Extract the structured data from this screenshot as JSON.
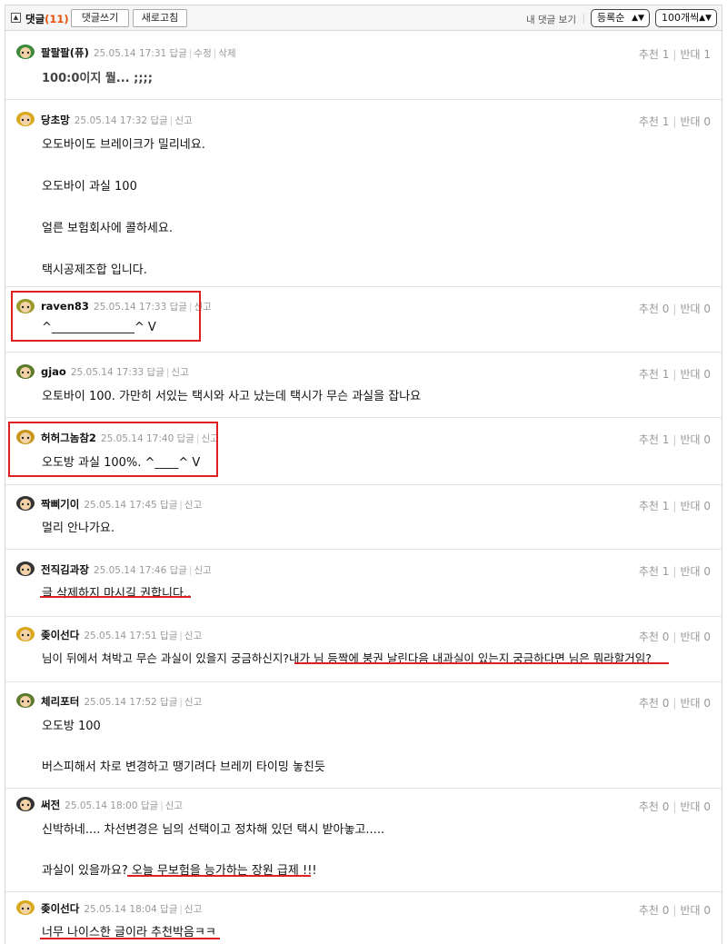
{
  "header": {
    "title": "댓글",
    "count": "(11)",
    "write_button": "댓글쓰기",
    "refresh_button": "새로고침",
    "my_comments": "내 댓글 보기",
    "sort_select": "등록순",
    "per_page_select": "100개씩"
  },
  "actions": {
    "reply": "답글",
    "edit": "수정",
    "delete": "삭제",
    "report": "신고",
    "up": "추천",
    "down": "반대"
  },
  "comments": [
    {
      "author": "팔팔팔(퓨)",
      "time": "25.05.14 17:31",
      "own": true,
      "up": "1",
      "down": "1",
      "lines": [
        "100:0이지 뭘... ;;;;"
      ],
      "avatar_color": "#3c8a3c"
    },
    {
      "author": "당초망",
      "time": "25.05.14 17:32",
      "own": false,
      "up": "1",
      "down": "0",
      "lines": [
        "오도바이도 브레이크가 밀리네요.",
        "오도바이 과실 100",
        "얼른 보험회사에 콜하세요.",
        "택시공제조합 입니다."
      ],
      "avatar_color": "#d9a81c"
    },
    {
      "author": "raven83",
      "time": "25.05.14 17:33",
      "own": false,
      "up": "0",
      "down": "0",
      "lines": [
        "^______________^ V"
      ],
      "avatar_color": "#9a9a2c"
    },
    {
      "author": "gjao",
      "time": "25.05.14 17:33",
      "own": false,
      "up": "1",
      "down": "0",
      "lines": [
        "오토바이 100. 가만히 서있는 택시와 사고 났는데 택시가 무슨 과실을 잡나요"
      ],
      "avatar_color": "#5b7a2c"
    },
    {
      "author": "허허그놈참2",
      "time": "25.05.14 17:40",
      "own": false,
      "up": "1",
      "down": "0",
      "lines": [
        "오도방 과실 100%. ^____^ V"
      ],
      "avatar_color": "#c8961c"
    },
    {
      "author": "짝삐기이",
      "time": "25.05.14 17:45",
      "own": false,
      "up": "1",
      "down": "0",
      "lines": [
        "멀리 안나가요."
      ],
      "avatar_color": "#333333"
    },
    {
      "author": "전직김과장",
      "time": "25.05.14 17:46",
      "own": false,
      "up": "1",
      "down": "0",
      "lines": [
        "글 삭제하지 마시길 권합니다.."
      ],
      "avatar_color": "#333333"
    },
    {
      "author": "좆이선다",
      "time": "25.05.14 17:51",
      "own": false,
      "up": "0",
      "down": "0",
      "lines": [
        "님이 뒤에서 쳐박고 무슨 과실이 있을지 궁금하신지?내가 님 등짝에 붕권 날린다음 내과실이 있는지 궁금하다면 님은 뭐라할거임?"
      ],
      "avatar_color": "#d9a81c"
    },
    {
      "author": "체리포터",
      "time": "25.05.14 17:52",
      "own": false,
      "up": "0",
      "down": "0",
      "lines": [
        "오도방 100",
        "버스피해서 차로 변경하고 땡기려다 브레끼 타이밍 놓친듯"
      ],
      "avatar_color": "#5b7a2c"
    },
    {
      "author": "써전",
      "time": "25.05.14 18:00",
      "own": false,
      "up": "0",
      "down": "0",
      "lines": [
        "신박하네.... 차선변경은 님의 선택이고 정차해 있던 택시 받아놓고.....",
        "과실이 있을까요? 오늘 무보험을 능가하는 장원 급제 !!!"
      ],
      "avatar_color": "#333333"
    },
    {
      "author": "좆이선다",
      "time": "25.05.14 18:04",
      "own": false,
      "up": "0",
      "down": "0",
      "lines": [
        "너무 나이스한 글이라 추천박음ㅋㅋ"
      ],
      "avatar_color": "#d9a81c"
    }
  ]
}
